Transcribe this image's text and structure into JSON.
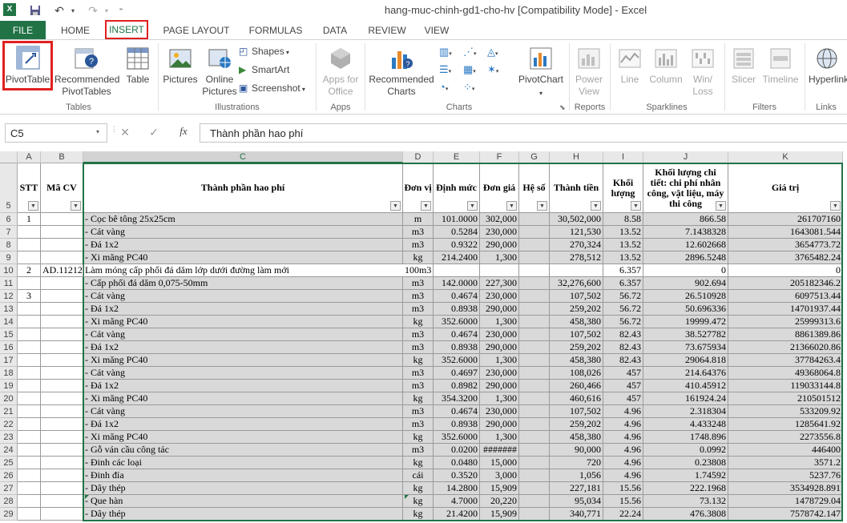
{
  "window": {
    "title": "hang-muc-chinh-gd1-cho-hv  [Compatibility Mode] - Excel",
    "app_icon": "excel-icon"
  },
  "tabs": [
    "FILE",
    "HOME",
    "INSERT",
    "PAGE LAYOUT",
    "FORMULAS",
    "DATA",
    "REVIEW",
    "VIEW"
  ],
  "active_tab": "INSERT",
  "ribbon": {
    "tables": {
      "label": "Tables",
      "pivottable": "PivotTable",
      "rec_pivot_1": "Recommended",
      "rec_pivot_2": "PivotTables",
      "table": "Table"
    },
    "illustrations": {
      "label": "Illustrations",
      "pictures": "Pictures",
      "online_1": "Online",
      "online_2": "Pictures",
      "shapes": "Shapes",
      "smartart": "SmartArt",
      "screenshot": "Screenshot"
    },
    "apps": {
      "label": "Apps",
      "apps_1": "Apps for",
      "apps_2": "Office"
    },
    "charts": {
      "label": "Charts",
      "rec_1": "Recommended",
      "rec_2": "Charts",
      "pivotchart": "PivotChart"
    },
    "reports": {
      "label": "Reports",
      "power_1": "Power",
      "power_2": "View"
    },
    "sparklines": {
      "label": "Sparklines",
      "line": "Line",
      "column": "Column",
      "winloss_1": "Win/",
      "winloss_2": "Loss"
    },
    "filters": {
      "label": "Filters",
      "slicer": "Slicer",
      "timeline": "Timeline"
    },
    "links": {
      "label": "Links",
      "hyperlink": "Hyperlink"
    }
  },
  "formula_bar": {
    "name_box": "C5",
    "cancel": "✕",
    "enter": "✓",
    "fx": "fx",
    "content": "Thành phần hao phí"
  },
  "columns": [
    "A",
    "B",
    "C",
    "D",
    "E",
    "F",
    "G",
    "H",
    "I",
    "J",
    "K"
  ],
  "header_row": {
    "row_num": "5",
    "stt": "STT",
    "ma_cv": "Mã CV",
    "thanh_phan": "Thành phần hao phí",
    "don_vi": "Đơn vị",
    "dinh_muc": "Định mức",
    "don_gia": "Đơn giá",
    "he_so": "Hệ số",
    "thanh_tien": "Thành tiền",
    "khoi_luong": "Khối lượng",
    "kl_chi_tiet": "Khối lượng chi tiết: chi phí nhân công, vật liệu, máy thi công",
    "gia_tri": "Giá trị"
  },
  "rows": [
    {
      "n": "6",
      "a": "1",
      "b": "",
      "c": "- Cọc bê tông 25x25cm",
      "d": "m",
      "e": "101.0000",
      "f": "302,000",
      "g": "",
      "h": "30,502,000",
      "i": "8.58",
      "j": "866.58",
      "k": "261707160",
      "gray": true
    },
    {
      "n": "7",
      "a": "",
      "b": "",
      "c": "- Cát vàng",
      "d": "m3",
      "e": "0.5284",
      "f": "230,000",
      "g": "",
      "h": "121,530",
      "i": "13.52",
      "j": "7.1438328",
      "k": "1643081.544",
      "gray": true
    },
    {
      "n": "8",
      "a": "",
      "b": "",
      "c": "- Đá 1x2",
      "d": "m3",
      "e": "0.9322",
      "f": "290,000",
      "g": "",
      "h": "270,324",
      "i": "13.52",
      "j": "12.602668",
      "k": "3654773.72",
      "gray": true
    },
    {
      "n": "9",
      "a": "",
      "b": "",
      "c": "- Xi măng PC40",
      "d": "kg",
      "e": "214.2400",
      "f": "1,300",
      "g": "",
      "h": "278,512",
      "i": "13.52",
      "j": "2896.5248",
      "k": "3765482.24",
      "gray": true
    },
    {
      "n": "10",
      "a": "2",
      "b": "AD.11212",
      "c": "Làm móng cấp phối đá dăm lớp dưới đường làm mới",
      "d": "100m3",
      "e": "",
      "f": "",
      "g": "",
      "h": "",
      "i": "6.357",
      "j": "0",
      "k": "0",
      "gray": false
    },
    {
      "n": "11",
      "a": "",
      "b": "",
      "c": "- Cấp phối đá dăm 0,075-50mm",
      "d": "m3",
      "e": "142.0000",
      "f": "227,300",
      "g": "",
      "h": "32,276,600",
      "i": "6.357",
      "j": "902.694",
      "k": "205182346.2",
      "gray": true
    },
    {
      "n": "12",
      "a": "3",
      "b": "",
      "c": "- Cát vàng",
      "d": "m3",
      "e": "0.4674",
      "f": "230,000",
      "g": "",
      "h": "107,502",
      "i": "56.72",
      "j": "26.510928",
      "k": "6097513.44",
      "gray": true
    },
    {
      "n": "13",
      "a": "",
      "b": "",
      "c": "- Đá 1x2",
      "d": "m3",
      "e": "0.8938",
      "f": "290,000",
      "g": "",
      "h": "259,202",
      "i": "56.72",
      "j": "50.696336",
      "k": "14701937.44",
      "gray": true
    },
    {
      "n": "14",
      "a": "",
      "b": "",
      "c": "- Xi măng PC40",
      "d": "kg",
      "e": "352.6000",
      "f": "1,300",
      "g": "",
      "h": "458,380",
      "i": "56.72",
      "j": "19999.472",
      "k": "25999313.6",
      "gray": true
    },
    {
      "n": "15",
      "a": "",
      "b": "",
      "c": "- Cát vàng",
      "d": "m3",
      "e": "0.4674",
      "f": "230,000",
      "g": "",
      "h": "107,502",
      "i": "82.43",
      "j": "38.527782",
      "k": "8861389.86",
      "gray": true
    },
    {
      "n": "16",
      "a": "",
      "b": "",
      "c": "- Đá 1x2",
      "d": "m3",
      "e": "0.8938",
      "f": "290,000",
      "g": "",
      "h": "259,202",
      "i": "82.43",
      "j": "73.675934",
      "k": "21366020.86",
      "gray": true
    },
    {
      "n": "17",
      "a": "",
      "b": "",
      "c": "- Xi măng PC40",
      "d": "kg",
      "e": "352.6000",
      "f": "1,300",
      "g": "",
      "h": "458,380",
      "i": "82.43",
      "j": "29064.818",
      "k": "37784263.4",
      "gray": true
    },
    {
      "n": "18",
      "a": "",
      "b": "",
      "c": "- Cát vàng",
      "d": "m3",
      "e": "0.4697",
      "f": "230,000",
      "g": "",
      "h": "108,026",
      "i": "457",
      "j": "214.64376",
      "k": "49368064.8",
      "gray": true
    },
    {
      "n": "19",
      "a": "",
      "b": "",
      "c": "- Đá 1x2",
      "d": "m3",
      "e": "0.8982",
      "f": "290,000",
      "g": "",
      "h": "260,466",
      "i": "457",
      "j": "410.45912",
      "k": "119033144.8",
      "gray": true
    },
    {
      "n": "20",
      "a": "",
      "b": "",
      "c": "- Xi măng PC40",
      "d": "kg",
      "e": "354.3200",
      "f": "1,300",
      "g": "",
      "h": "460,616",
      "i": "457",
      "j": "161924.24",
      "k": "210501512",
      "gray": true
    },
    {
      "n": "21",
      "a": "",
      "b": "",
      "c": "- Cát vàng",
      "d": "m3",
      "e": "0.4674",
      "f": "230,000",
      "g": "",
      "h": "107,502",
      "i": "4.96",
      "j": "2.318304",
      "k": "533209.92",
      "gray": true
    },
    {
      "n": "22",
      "a": "",
      "b": "",
      "c": "- Đá 1x2",
      "d": "m3",
      "e": "0.8938",
      "f": "290,000",
      "g": "",
      "h": "259,202",
      "i": "4.96",
      "j": "4.433248",
      "k": "1285641.92",
      "gray": true
    },
    {
      "n": "23",
      "a": "",
      "b": "",
      "c": "- Xi măng PC40",
      "d": "kg",
      "e": "352.6000",
      "f": "1,300",
      "g": "",
      "h": "458,380",
      "i": "4.96",
      "j": "1748.896",
      "k": "2273556.8",
      "gray": true
    },
    {
      "n": "24",
      "a": "",
      "b": "",
      "c": "- Gỗ ván cầu công tác",
      "d": "m3",
      "e": "0.0200",
      "f": "#######",
      "g": "",
      "h": "90,000",
      "i": "4.96",
      "j": "0.0992",
      "k": "446400",
      "gray": true
    },
    {
      "n": "25",
      "a": "",
      "b": "",
      "c": "- Đinh các loại",
      "d": "kg",
      "e": "0.0480",
      "f": "15,000",
      "g": "",
      "h": "720",
      "i": "4.96",
      "j": "0.23808",
      "k": "3571.2",
      "gray": true
    },
    {
      "n": "26",
      "a": "",
      "b": "",
      "c": "- Đinh đỉa",
      "d": "cái",
      "e": "0.3520",
      "f": "3,000",
      "g": "",
      "h": "1,056",
      "i": "4.96",
      "j": "1.74592",
      "k": "5237.76",
      "gray": true
    },
    {
      "n": "27",
      "a": "",
      "b": "",
      "c": "- Dây thép",
      "d": "kg",
      "e": "14.2800",
      "f": "15,909",
      "g": "",
      "h": "227,181",
      "i": "15.56",
      "j": "222.1968",
      "k": "3534928.891",
      "gray": true
    },
    {
      "n": "28",
      "a": "",
      "b": "",
      "c": "- Que hàn",
      "d": "kg",
      "e": "4.7000",
      "f": "20,220",
      "g": "",
      "h": "95,034",
      "i": "15.56",
      "j": "73.132",
      "k": "1478729.04",
      "gray": true
    },
    {
      "n": "29",
      "a": "",
      "b": "",
      "c": "- Dây thép",
      "d": "kg",
      "e": "21.4200",
      "f": "15,909",
      "g": "",
      "h": "340,771",
      "i": "22.24",
      "j": "476.3808",
      "k": "7578742.147",
      "gray": true
    }
  ],
  "colors": {
    "excel_green": "#217346",
    "highlight_red": "#e02020",
    "cell_gray": "#d9d9d9"
  }
}
